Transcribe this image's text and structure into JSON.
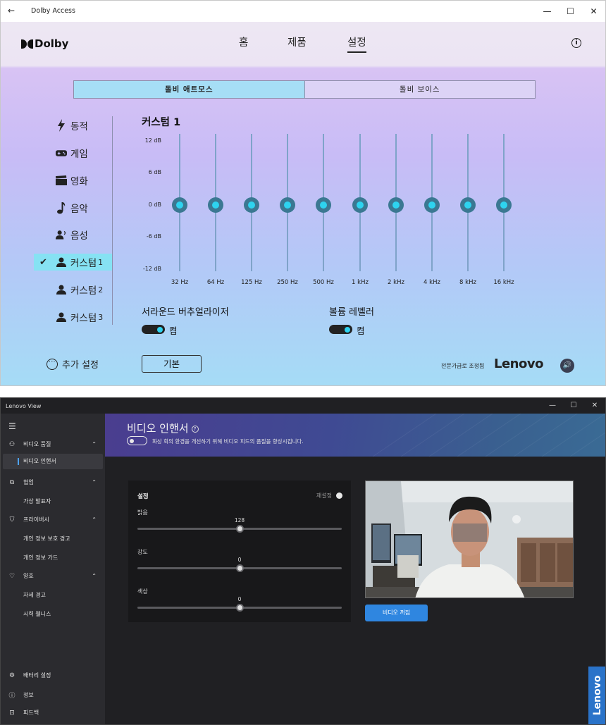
{
  "dolby": {
    "window_title": "Dolby Access",
    "logo_text": "Dolby",
    "nav": [
      "홈",
      "제품",
      "설정"
    ],
    "tabs": {
      "atmos": "돌비 애트모스",
      "voice": "돌비 보이스"
    },
    "profiles": [
      {
        "label": "동적"
      },
      {
        "label": "게임"
      },
      {
        "label": "영화"
      },
      {
        "label": "음악"
      },
      {
        "label": "음성"
      },
      {
        "label": "커스텀",
        "num": "1"
      },
      {
        "label": "커스텀",
        "num": "2"
      },
      {
        "label": "커스텀",
        "num": "3"
      }
    ],
    "more_settings": "추가 설정",
    "eq": {
      "title": "커스텀 1",
      "db_labels": [
        "12 dB",
        "6 dB",
        "0 dB",
        "-6 dB",
        "-12 dB"
      ],
      "bands": [
        "32 Hz",
        "64 Hz",
        "125 Hz",
        "250 Hz",
        "500 Hz",
        "1 kHz",
        "2 kHz",
        "4 kHz",
        "8 kHz",
        "16 kHz"
      ],
      "gains_db": [
        0,
        0,
        0,
        0,
        0,
        0,
        0,
        0,
        0,
        0
      ]
    },
    "surround": {
      "label": "서라운드 버추얼라이저",
      "state": "켬"
    },
    "volume_leveler": {
      "label": "볼륨 레벨러",
      "state": "켬"
    },
    "reset_button": "기본",
    "tuned_by": "전문가급로 조정됨",
    "lenovo": "Lenovo"
  },
  "lenovo_view": {
    "window_title": "Lenovo View",
    "sidebar": {
      "groups": [
        {
          "label": "비디오 품질",
          "icon": "video-quality-icon",
          "items": [
            "비디오 인핸서"
          ]
        },
        {
          "label": "협업",
          "icon": "collaboration-icon",
          "items": [
            "가상 발표자"
          ]
        },
        {
          "label": "프라이버시",
          "icon": "privacy-shield-icon",
          "items": [
            "개인 정보 보호 경고",
            "개인 정보 가드"
          ]
        },
        {
          "label": "양호",
          "icon": "health-heart-icon",
          "items": [
            "자세 경고",
            "시력 웰니스"
          ]
        }
      ],
      "bottom": [
        {
          "label": "배터리 설정",
          "icon": "gear-icon"
        },
        {
          "label": "정보",
          "icon": "info-icon"
        },
        {
          "label": "피드백",
          "icon": "feedback-icon"
        }
      ]
    },
    "page_title": "비디오 인핸서",
    "description": "화상 회의 환경을 개선하기 위해 비디오 피드의 품질을 향상시킵니다.",
    "settings": {
      "heading": "설정",
      "reset": "재설정",
      "sliders": [
        {
          "label": "밝음",
          "value": "128",
          "fraction": 0.5
        },
        {
          "label": "강도",
          "value": "0",
          "fraction": 0.5
        },
        {
          "label": "색상",
          "value": "0",
          "fraction": 0.5
        }
      ]
    },
    "video_button": "비디오 꺼짐",
    "brand": "Lenovo",
    "colors": {
      "accent": "#2f86e0",
      "brand": "#2a73c9"
    }
  }
}
